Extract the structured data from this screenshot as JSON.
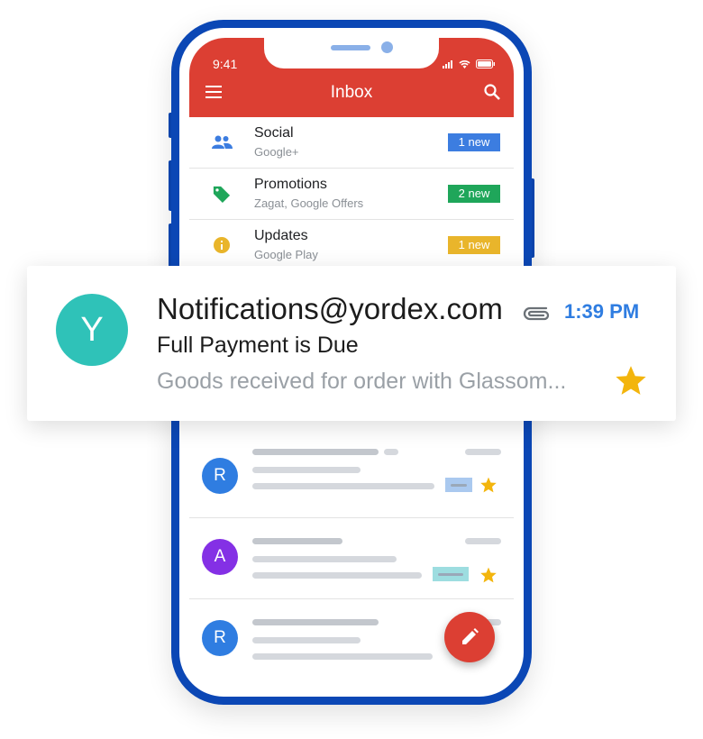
{
  "status_bar": {
    "time": "9:41"
  },
  "app_bar": {
    "title": "Inbox",
    "menu_icon": "menu-icon",
    "search_icon": "search-icon"
  },
  "categories": [
    {
      "name": "Social",
      "subtitle": "Google+",
      "badge": "1 new",
      "icon": "people-icon",
      "color": "#3c7de0"
    },
    {
      "name": "Promotions",
      "subtitle": "Zagat, Google Offers",
      "badge": "2 new",
      "icon": "tag-icon",
      "color": "#1fa65a"
    },
    {
      "name": "Updates",
      "subtitle": "Google Play",
      "badge": "1 new",
      "icon": "info-icon",
      "color": "#e9b52b"
    }
  ],
  "email_rows": [
    {
      "avatar": "R",
      "avatar_color": "#2f7de1",
      "label_color": "#aac9ef",
      "starred": true
    },
    {
      "avatar": "A",
      "avatar_color": "#8430e5",
      "label_color": "#9ddde0",
      "starred": true
    },
    {
      "avatar": "R",
      "avatar_color": "#2f7de1",
      "starred": false
    }
  ],
  "featured_email": {
    "avatar": "Y",
    "avatar_color": "#2fc2b8",
    "from": "Notifications@yordex.com",
    "time": "1:39 PM",
    "subject": "Full Payment is Due",
    "snippet": "Goods received for order with Glassom...",
    "starred": true,
    "has_attachment": true
  },
  "fab": {
    "icon": "pencil-icon"
  },
  "colors": {
    "app_bar": "#dc3f33",
    "phone_frame": "#0b47b5",
    "star": "#f3b50d",
    "time_accent": "#2f7de1"
  }
}
